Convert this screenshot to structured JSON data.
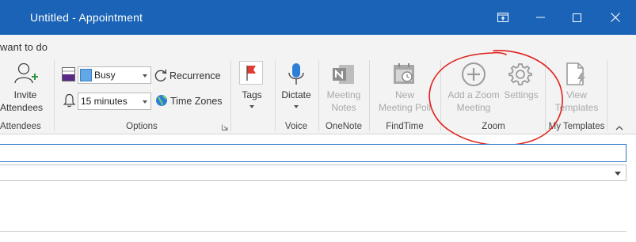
{
  "window": {
    "title": "Untitled  -  Appointment",
    "title_bar_color": "#1a63b7"
  },
  "tell_me": {
    "text": "want to do"
  },
  "ribbon": {
    "attendees": {
      "invite_label_line1": "Invite",
      "invite_label_line2": "Attendees",
      "group_label": "Attendees"
    },
    "options": {
      "show_as_value": "Busy",
      "reminder_value": "15 minutes",
      "recurrence_label": "Recurrence",
      "time_zones_label": "Time Zones",
      "group_label": "Options"
    },
    "tags": {
      "label": "Tags"
    },
    "voice": {
      "dictate_label": "Dictate",
      "group_label": "Voice"
    },
    "onenote": {
      "meeting_notes_line1": "Meeting",
      "meeting_notes_line2": "Notes",
      "group_label": "OneNote"
    },
    "findtime": {
      "new_poll_line1": "New",
      "new_poll_line2": "Meeting Poll",
      "group_label": "FindTime"
    },
    "zoom": {
      "add_zoom_line1": "Add a Zoom",
      "add_zoom_line2": "Meeting",
      "settings_label": "Settings",
      "group_label": "Zoom"
    },
    "my_templates": {
      "view_templates_line1": "View",
      "view_templates_line2": "Templates",
      "group_label": "My Templates"
    }
  },
  "colors": {
    "annotation": "#e0201c",
    "accent": "#2e75c8"
  }
}
